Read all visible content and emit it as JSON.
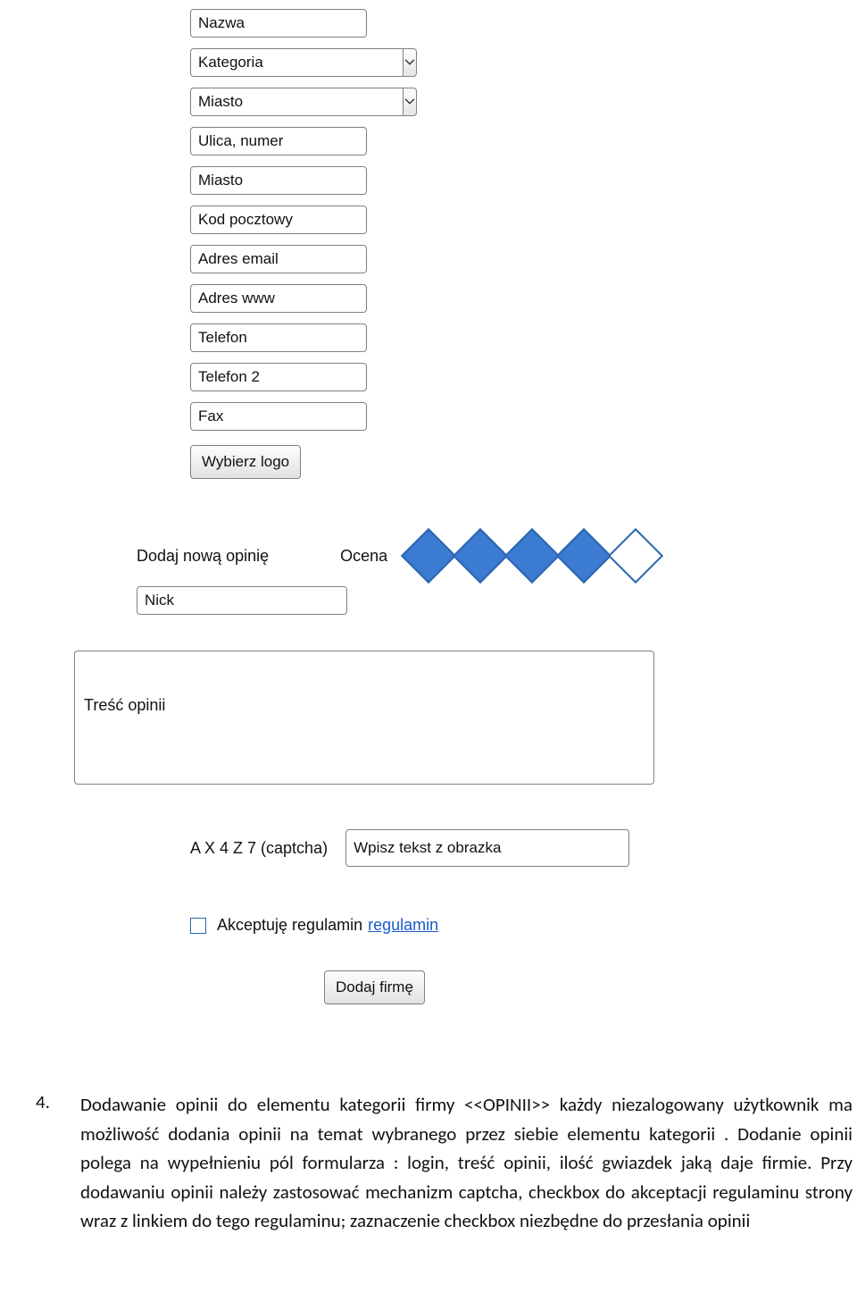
{
  "form": {
    "inputs": {
      "nazwa": "Nazwa",
      "kategoria": "Kategoria",
      "miasto1": "Miasto",
      "ulica": "Ulica, numer",
      "miasto2": "Miasto",
      "kod": "Kod pocztowy",
      "email": "Adres email",
      "www": "Adres www",
      "telefon": "Telefon",
      "telefon2": "Telefon 2",
      "fax": "Fax"
    },
    "logo_button": "Wybierz logo",
    "rating": {
      "add_label": "Dodaj nową opinię",
      "score_label": "Ocena",
      "value": 4,
      "max": 5
    },
    "nick_placeholder": "Nick",
    "opinion_placeholder": "Treść opinii",
    "captcha": {
      "label": "A X 4 Z 7 (captcha)",
      "placeholder": "Wpisz tekst z obrazka"
    },
    "accept": {
      "label": "Akceptuję regulamin",
      "link_text": "regulamin"
    },
    "submit": "Dodaj firmę"
  },
  "doc": {
    "list_no": "4.",
    "paragraph": "Dodawanie opinii do elementu kategorii firmy <<OPINII>> każdy niezalogowany użytkownik ma możliwość dodania opinii na temat wybranego przez siebie elementu kategorii . Dodanie opinii polega na wypełnieniu pól formularza : login, treść opinii, ilość gwiazdek jaką daje firmie. Przy dodawaniu opinii należy zastosować mechanizm captcha, checkbox do akceptacji regulaminu strony wraz z linkiem do tego regulaminu; zaznaczenie checkbox niezbędne do przesłania opinii"
  }
}
